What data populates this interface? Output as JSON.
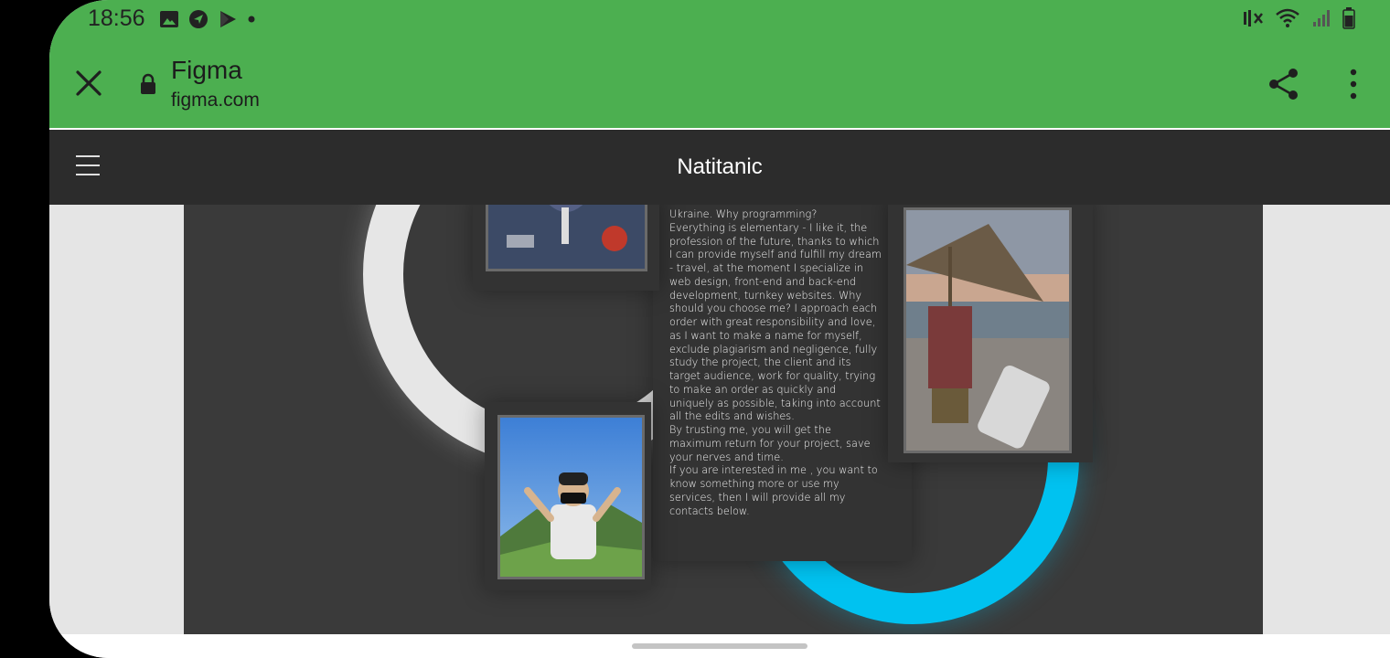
{
  "status_bar": {
    "time": "18:56",
    "left_icons": [
      "image-icon",
      "messenger-icon",
      "play-store-icon",
      "dot-icon"
    ],
    "right_icons": [
      "mute-icon",
      "wifi-icon",
      "signal-icon",
      "battery-icon"
    ]
  },
  "browser": {
    "title": "Figma",
    "url": "figma.com",
    "accent_color": "#4caf50"
  },
  "figma_prototype": {
    "title": "Natitanic",
    "background": "#2c2c2c"
  },
  "about": {
    "text": "Ukraine. Why programming?\nEverything is elementary - I like it, the profession of the future, thanks to which I can provide myself and fulfill my dream - travel, at the moment I specialize in web design, front-end and back-end development, turnkey websites. Why should you choose me? I approach each order with great responsibility and love, as I want to make a name for myself, exclude plagiarism and negligence, fully study the project, the client and its target audience, work for quality, trying to make an order as quickly and uniquely as possible, taking into account all the edits and wishes.\nBy trusting me, you will get the maximum return for your project, save your nerves and time.\nIf you are interested in me , you want to know something more or use my services, then I will provide all my contacts below.",
    "ring_colors": {
      "white": "#e6e6e6",
      "blue": "#00c2f0"
    }
  }
}
